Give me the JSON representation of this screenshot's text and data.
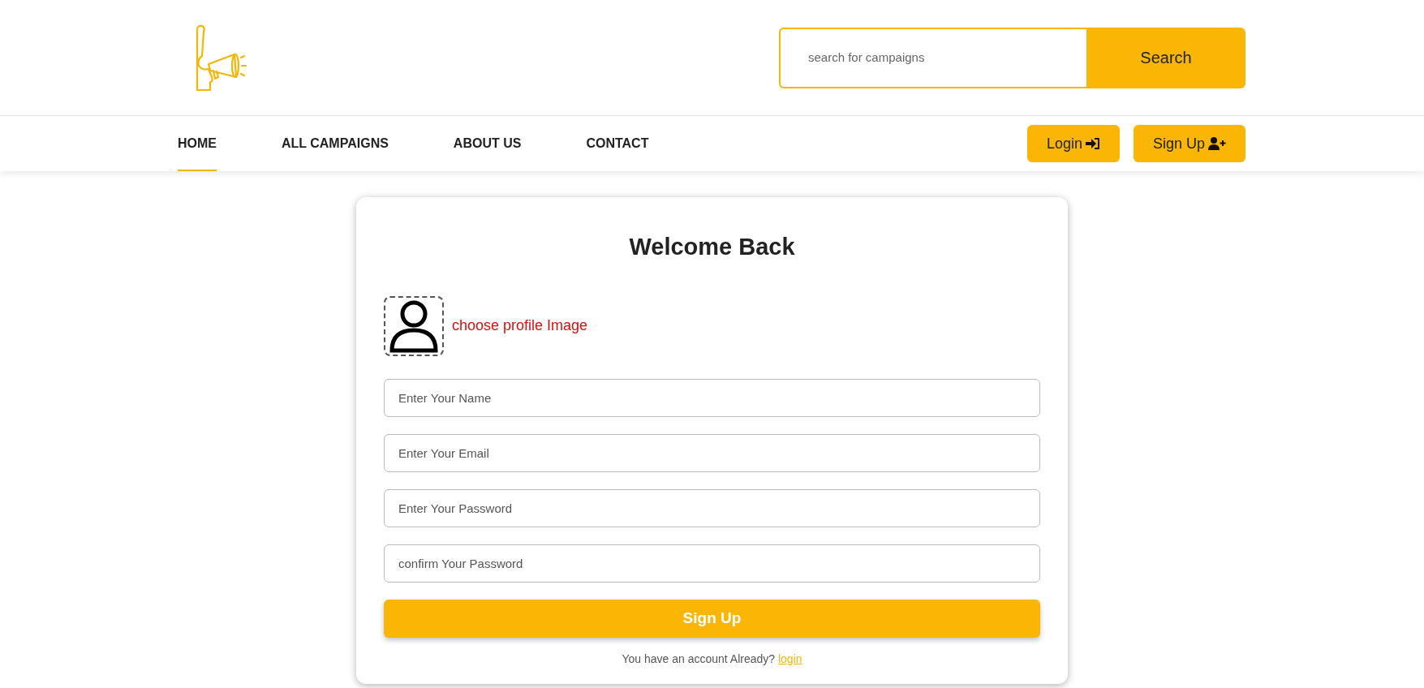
{
  "search": {
    "placeholder": "search for campaigns",
    "button": "Search"
  },
  "nav": [
    {
      "label": "HOME",
      "selected": true
    },
    {
      "label": "ALL CAMPAIGNS",
      "selected": false
    },
    {
      "label": "ABOUT US",
      "selected": false
    },
    {
      "label": "CONTACT",
      "selected": false
    }
  ],
  "auth_buttons": [
    {
      "label": "Login",
      "kind": "login"
    },
    {
      "label": "Sign Up",
      "kind": "signup"
    }
  ],
  "form": {
    "title": "Welcome Back",
    "profile_image_label": "choose profile Image",
    "fields": [
      {
        "placeholder": "Enter Your Name"
      },
      {
        "placeholder": "Enter Your Email"
      },
      {
        "placeholder": "Enter Your Password"
      },
      {
        "placeholder": "confirm Your Password"
      }
    ],
    "submit": "Sign Up",
    "footer_text": "You have an account Already?",
    "footer_link": "login"
  }
}
